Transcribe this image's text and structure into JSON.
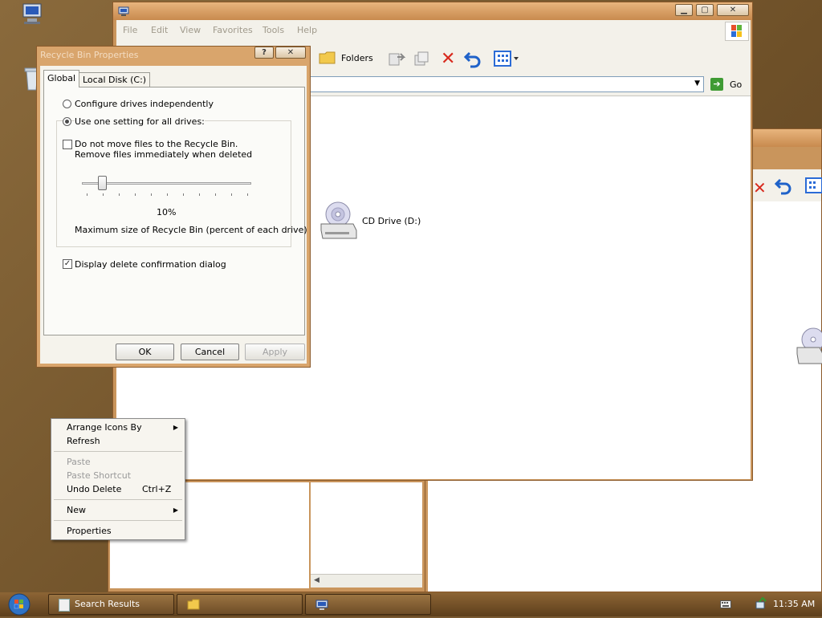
{
  "desktop": {
    "icons": [
      "computer-icon",
      "recycle-bin-icon"
    ]
  },
  "explorer_window": {
    "menu": [
      "File",
      "Edit",
      "View",
      "Favorites",
      "Tools",
      "Help"
    ],
    "toolbar": {
      "folders_label": "Folders"
    },
    "address": {
      "go_label": "Go"
    },
    "drive": {
      "label": "CD Drive (D:)"
    }
  },
  "dialog": {
    "title": "Recycle Bin Properties",
    "help_button": "?",
    "close_button": "✕",
    "tabs": [
      "Global",
      "Local Disk (C:)"
    ],
    "radio_independent": "Configure drives independently",
    "radio_one_setting": "Use one setting for all drives:",
    "checkbox_no_move_line1": "Do not move files to the Recycle Bin.",
    "checkbox_no_move_line2": "Remove files immediately when deleted",
    "slider_value": "10%",
    "slider_fraction": 0.1,
    "slider_caption": "Maximum size of Recycle Bin (percent of each drive)",
    "checkbox_confirm": "Display delete confirmation dialog",
    "ok": "OK",
    "cancel": "Cancel",
    "apply": "Apply"
  },
  "context_menu": {
    "arrange": "Arrange Icons By",
    "refresh": "Refresh",
    "paste": "Paste",
    "paste_shortcut": "Paste Shortcut",
    "undo_delete": "Undo Delete",
    "undo_shortcut": "Ctrl+Z",
    "new": "New",
    "properties": "Properties"
  },
  "taskbar": {
    "search_results": "Search Results",
    "clock": "11:35 AM"
  }
}
